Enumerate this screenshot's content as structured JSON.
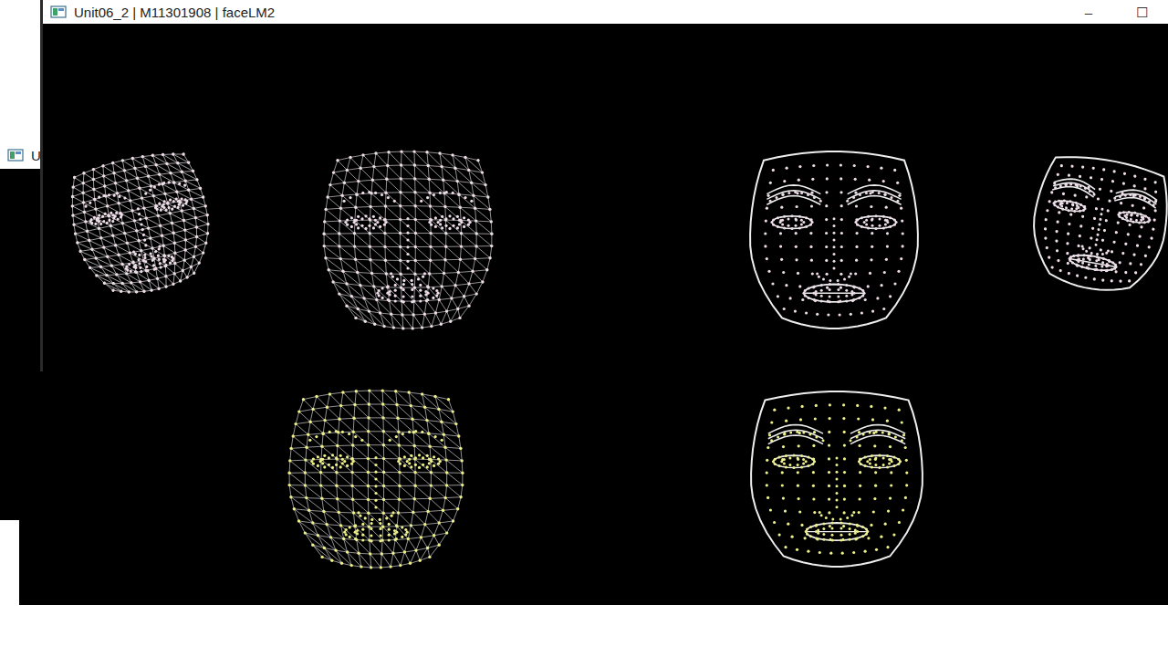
{
  "window": {
    "title": "Unit06_2 | M11301908 | faceLM2",
    "controls": [
      "–",
      "☐"
    ]
  },
  "background_windows": [
    {
      "title": "U"
    }
  ],
  "faces": [
    {
      "kind": "mesh",
      "color": "#eedde8"
    },
    {
      "kind": "mesh",
      "color": "#eedde8"
    },
    {
      "kind": "contour",
      "color": "#eedde8"
    },
    {
      "kind": "contour",
      "color": "#eedde8"
    },
    {
      "kind": "mesh",
      "color": "#eef08a"
    },
    {
      "kind": "contour",
      "color": "#eef08a"
    }
  ]
}
